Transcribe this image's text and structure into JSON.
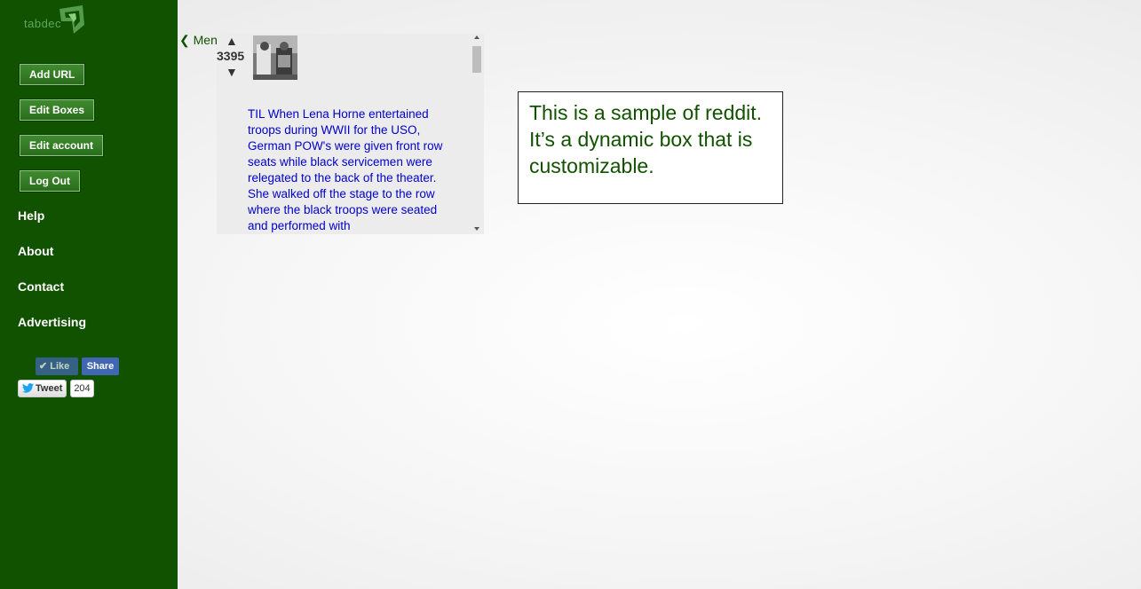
{
  "sidebar": {
    "logo_text": "tabdec",
    "buttons": {
      "add_url": "Add URL",
      "edit_boxes": "Edit Boxes",
      "edit_account": "Edit account",
      "log_out": "Log Out"
    },
    "links": {
      "help": "Help",
      "about": "About",
      "contact": "Contact",
      "advertising": "Advertising"
    },
    "social": {
      "like_label": "Like",
      "share_label": "Share",
      "tweet_label": "Tweet",
      "tweet_count": "204"
    }
  },
  "main": {
    "menu_label": "❮ Menu",
    "reddit_box": {
      "up_arrow": "▲",
      "score": "3395",
      "down_arrow": "▼",
      "post_title": "TIL When Lena Horne entertained troops during WWII for the USO, German POW's were given front row seats while black servicemen were relegated to the back of the theater. She walked off the stage to the row where the black troops were seated and performed with"
    },
    "info_box_text": "This is a sample of reddit. It’s a dynamic box that is customizable."
  },
  "colors": {
    "sidebar_bg": "#115200",
    "link_blue": "#0000cc",
    "info_text_green": "#115200",
    "facebook_blue": "#4267b2"
  }
}
